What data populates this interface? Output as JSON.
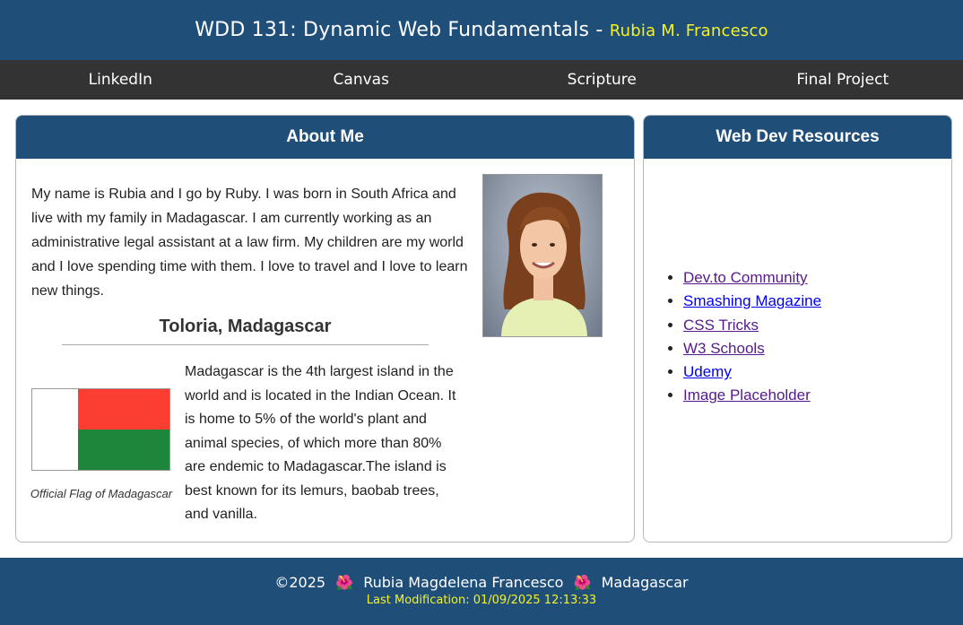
{
  "header": {
    "title": "WDD 131: Dynamic Web Fundamentals -",
    "name": "Rubia M. Francesco"
  },
  "nav": {
    "items": [
      "LinkedIn",
      "Canvas",
      "Scripture",
      "Final Project"
    ]
  },
  "about": {
    "heading": "About Me",
    "bio": "My name is Rubia and I go by Ruby. I was born in South Africa and live with my family in Madagascar. I am currently working as an administrative legal assistant at a law firm. My children are my world and I love spending time with them. I love to travel and I love to learn new things.",
    "place_title": "Toloria, Madagascar",
    "flag_caption": "Official Flag of Madagascar",
    "madagascar_text": "Madagascar is the 4th largest island in the world and is located in the Indian Ocean. It is home to 5% of the world's plant and animal species, of which more than 80% are endemic to Madagascar.The island is best known for its lemurs, baobab trees, and vanilla.",
    "flag_colors": {
      "white": "#ffffff",
      "red": "#fc3d32",
      "green": "#1e863a"
    }
  },
  "resources": {
    "heading": "Web Dev Resources",
    "links": [
      "Dev.to Community",
      "Smashing Magazine",
      "CSS Tricks",
      "W3 Schools",
      "Udemy",
      "Image Placeholder"
    ]
  },
  "footer": {
    "copyright": "©2025",
    "author": "Rubia Magdelena Francesco",
    "location": "Madagascar",
    "last_modified": "Last Modification: 01/09/2025 12:13:33",
    "flower_icon": "🌺"
  },
  "colors": {
    "primary": "#1f4e79",
    "nav": "#333333",
    "accent_yellow": "#f4f12a"
  }
}
